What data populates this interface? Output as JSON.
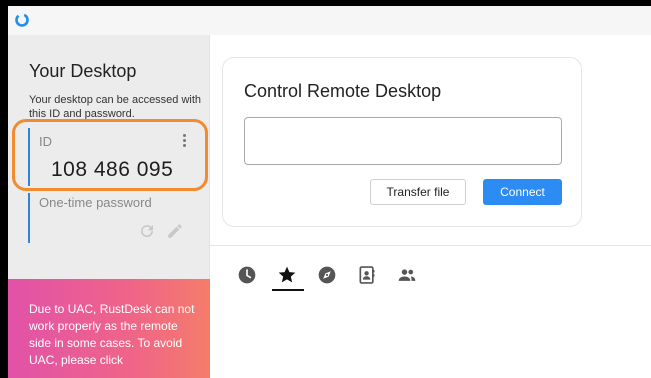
{
  "titlebar": {
    "logo_icon": "rustdesk-logo-icon"
  },
  "sidebar": {
    "title": "Your Desktop",
    "description": "Your desktop can be accessed with this ID and password.",
    "id_label": "ID",
    "id_value": "108 486 095",
    "password_label": "One-time password",
    "uac_message": "Due to UAC, RustDesk can not work properly as the remote side in some cases. To avoid UAC, please click"
  },
  "main": {
    "card_title": "Control Remote Desktop",
    "remote_id_value": "",
    "transfer_label": "Transfer file",
    "connect_label": "Connect",
    "tabs": [
      {
        "icon": "clock-icon",
        "name": "recent-sessions",
        "active": false
      },
      {
        "icon": "star-icon",
        "name": "favorites",
        "active": true
      },
      {
        "icon": "compass-icon",
        "name": "discovered",
        "active": false
      },
      {
        "icon": "address-book-icon",
        "name": "address-book",
        "active": false
      },
      {
        "icon": "group-icon",
        "name": "group",
        "active": false
      }
    ]
  },
  "colors": {
    "accent": "#2c8cf4",
    "id_border": "#2f86d6",
    "highlight": "#f28a30",
    "uac_gradient_start": "#e152a8",
    "uac_gradient_end": "#f57c6a"
  }
}
